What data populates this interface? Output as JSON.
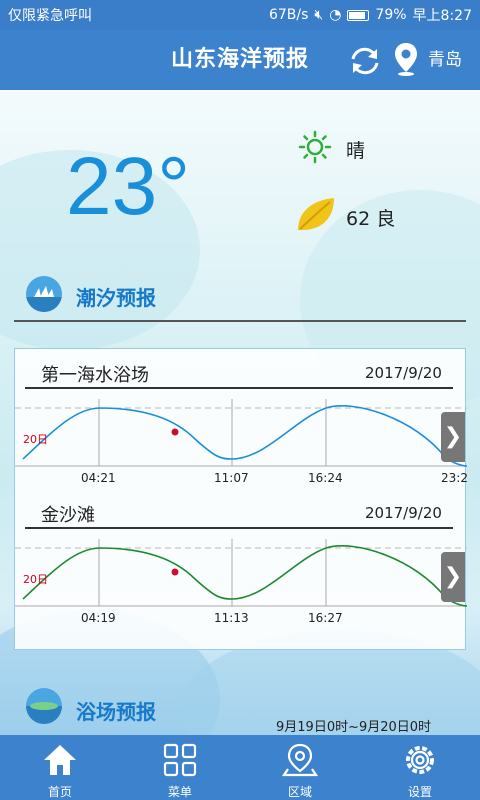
{
  "status_bar": {
    "carrier": "仅限紧急呼叫",
    "speed": "67B/s",
    "battery": "79%",
    "time": "早上8:27"
  },
  "header": {
    "title": "山东海洋预报",
    "city": "青岛"
  },
  "weather": {
    "temperature": "23°",
    "condition": "晴",
    "aqi": "62 良"
  },
  "tide_section": {
    "title": "潮汐预报",
    "beaches": [
      {
        "name": "第一海水浴场",
        "date": "2017/9/20",
        "y_label": "20日",
        "ticks": [
          "04:21",
          "11:07",
          "16:24",
          "23:2"
        ],
        "curve_color": "#1a8fd9"
      },
      {
        "name": "金沙滩",
        "date": "2017/9/20",
        "y_label": "20日",
        "ticks": [
          "04:19",
          "11:13",
          "16:27"
        ],
        "curve_color": "#1b8a2f"
      }
    ]
  },
  "bath_section": {
    "title": "浴场预报",
    "range": "9月19日0时~9月20日0时"
  },
  "tabs": [
    {
      "label": "首页",
      "icon": "home-icon"
    },
    {
      "label": "菜单",
      "icon": "grid-icon"
    },
    {
      "label": "区域",
      "icon": "map-pin-icon"
    },
    {
      "label": "设置",
      "icon": "gear-icon"
    }
  ],
  "colors": {
    "primary": "#3c82cc",
    "temperature": "#1a8fd9",
    "section_title": "#1779c9",
    "marker": "#c8102e"
  }
}
